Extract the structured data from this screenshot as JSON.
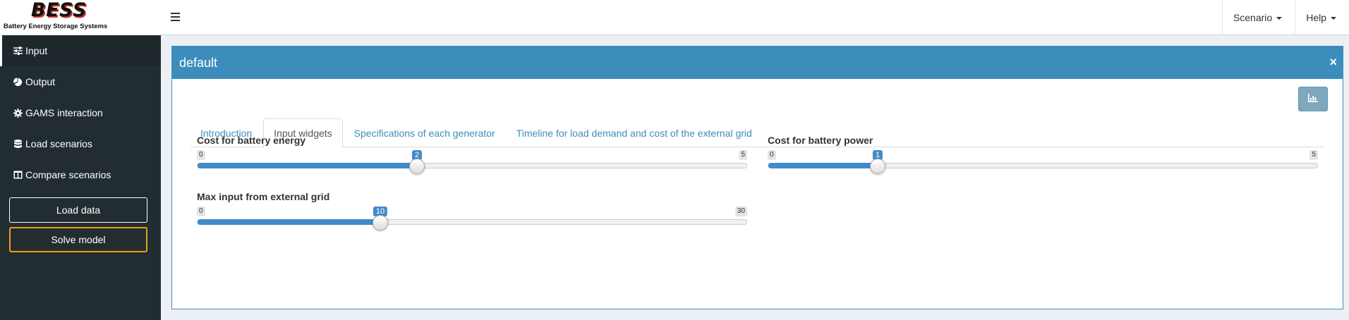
{
  "header": {
    "logo_title": "BESS",
    "logo_subtitle": "Battery Energy Storage Systems",
    "nav": [
      {
        "label": "Scenario"
      },
      {
        "label": "Help"
      }
    ]
  },
  "sidebar": {
    "items": [
      {
        "label": "Input",
        "icon": "sliders-icon",
        "active": true
      },
      {
        "label": "Output",
        "icon": "pie-chart-icon"
      },
      {
        "label": "GAMS interaction",
        "icon": "gear-icon"
      },
      {
        "label": "Load scenarios",
        "icon": "database-icon"
      },
      {
        "label": "Compare scenarios",
        "icon": "columns-icon"
      }
    ],
    "load_data_label": "Load data",
    "solve_model_label": "Solve model"
  },
  "box": {
    "title": "default",
    "close_glyph": "×",
    "chart_button_icon": "bar-chart-icon"
  },
  "tabs": [
    {
      "label": "Introduction",
      "active": false
    },
    {
      "label": "Input widgets",
      "active": true
    },
    {
      "label": "Specifications of each generator",
      "active": false
    },
    {
      "label": "Timeline for load demand and cost of the external grid",
      "active": false
    }
  ],
  "sliders": [
    {
      "label": "Cost for battery energy",
      "min": "0",
      "max": "5",
      "value": "2",
      "fraction": 0.4
    },
    {
      "label": "Cost for battery power",
      "min": "0",
      "max": "5",
      "value": "1",
      "fraction": 0.2
    },
    {
      "label": "Max input from external grid",
      "min": "0",
      "max": "30",
      "value": "10",
      "fraction": 0.3333
    }
  ],
  "colors": {
    "primary": "#3c8dbc",
    "slider_fill": "#428bca",
    "sidebar_bg": "#222d32",
    "solve_border": "#f39c12"
  }
}
